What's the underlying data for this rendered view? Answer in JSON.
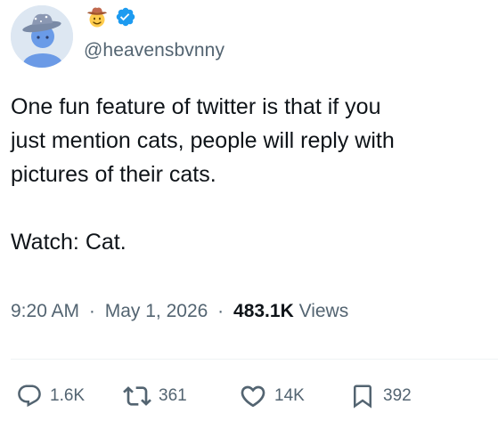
{
  "author": {
    "handle": "@heavensbvnny",
    "emoji_badge": "cowboy-hat-face-icon",
    "verified_badge": "verified-badge-icon"
  },
  "tweet": {
    "text": "One fun feature of twitter is that if you\njust mention cats, people will reply with\npictures of their cats.\n\nWatch: Cat."
  },
  "meta": {
    "time": "9:20 AM",
    "separator": "·",
    "date": "May 1, 2026",
    "views_count": "483.1K",
    "views_label": "Views"
  },
  "actions": {
    "reply_count": "1.6K",
    "retweet_count": "361",
    "like_count": "14K",
    "bookmark_count": "392"
  },
  "colors": {
    "text": "#0f1419",
    "secondary": "#536471",
    "verified": "#1d9bf0",
    "divider": "#eff3f4"
  }
}
